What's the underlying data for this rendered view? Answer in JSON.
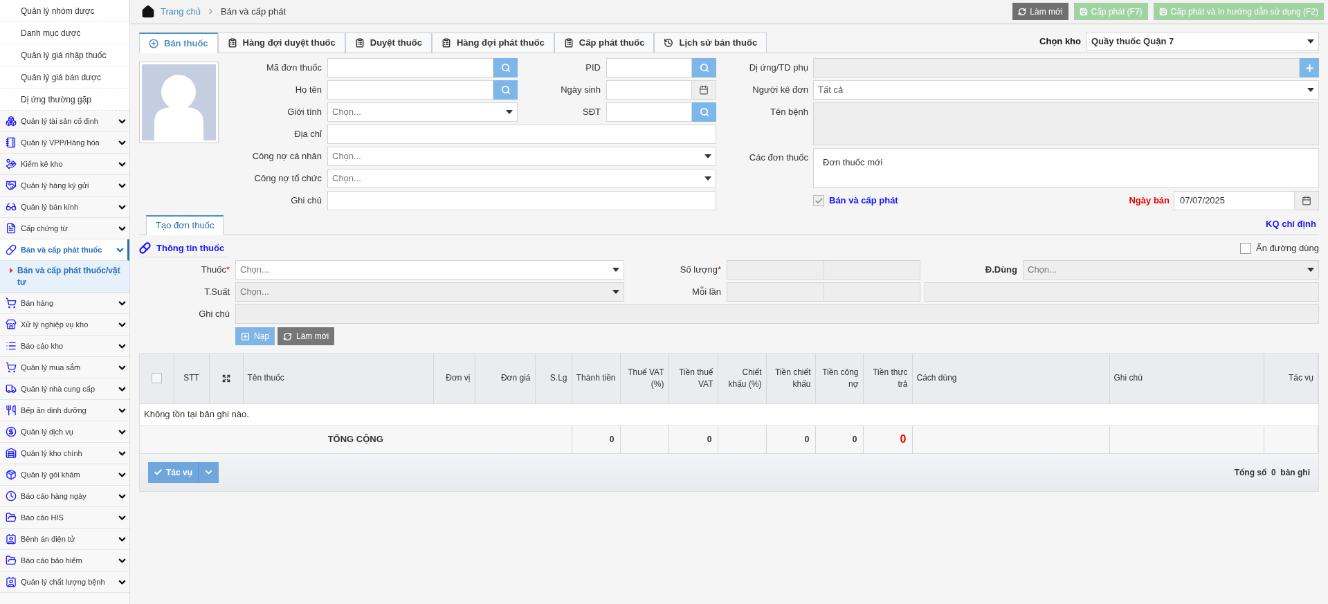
{
  "sidebar": {
    "submenu": [
      {
        "label": "Quản lý nhóm dược",
        "selected": false
      },
      {
        "label": "Danh mục dược",
        "selected": false
      },
      {
        "label": "Quản lý giá nhập thuốc",
        "selected": false
      },
      {
        "label": "Quản lý giá bán dược",
        "selected": false
      },
      {
        "label": "Dị ứng thường gặp",
        "selected": false
      }
    ],
    "items": [
      {
        "label": "Quản lý tài sản cố định",
        "selected": false
      },
      {
        "label": "Quản lý VPP/Hàng hóa",
        "selected": false
      },
      {
        "label": "Kiểm kê kho",
        "selected": false
      },
      {
        "label": "Quản lý hàng ký gửi",
        "selected": false
      },
      {
        "label": "Quản lý bán kính",
        "selected": false
      },
      {
        "label": "Cấp chứng từ",
        "selected": false
      },
      {
        "label": "Bán và cấp phát thuốc",
        "selected": true,
        "children": [
          {
            "label": "Bán và cấp phát thuốc/vật tư",
            "selected": true
          }
        ]
      },
      {
        "label": "Bán hàng",
        "selected": false
      },
      {
        "label": "Xử lý nghiệp vụ kho",
        "selected": false
      },
      {
        "label": "Báo cáo kho",
        "selected": false
      },
      {
        "label": "Quản lý mua sắm",
        "selected": false
      },
      {
        "label": "Quản lý nhà cung cấp",
        "selected": false
      },
      {
        "label": "Bếp ăn dinh dưỡng",
        "selected": false
      },
      {
        "label": "Quản lý dịch vụ",
        "selected": false
      },
      {
        "label": "Quản lý kho chính",
        "selected": false
      },
      {
        "label": "Quản lý gói khám",
        "selected": false
      },
      {
        "label": "Báo cáo hàng ngày",
        "selected": false
      },
      {
        "label": "Báo cáo HIS",
        "selected": false
      },
      {
        "label": "Bệnh án điện tử",
        "selected": false
      },
      {
        "label": "Báo cáo bảo hiểm",
        "selected": false
      },
      {
        "label": "Quản lý chất lượng bệnh",
        "selected": false
      }
    ]
  },
  "breadcrumb": [
    {
      "label": "Trang chủ",
      "kind": "link"
    },
    {
      "label": "Bán và cấp phát",
      "kind": "current"
    }
  ],
  "actions": [
    {
      "label": "Làm mới",
      "kind": "refresh",
      "disabled": false
    },
    {
      "label": "Cấp phát (F7)",
      "kind": "save",
      "disabled": true
    },
    {
      "label": "Cấp phát và In hướng dẫn sử dụng (F2)",
      "kind": "save",
      "disabled": true
    }
  ],
  "tabs": [
    {
      "label": "Bán thuốc",
      "selected": true
    },
    {
      "label": "Hàng đợi duyệt thuốc",
      "selected": false
    },
    {
      "label": "Duyệt thuốc",
      "selected": false
    },
    {
      "label": "Hàng đợi phát thuốc",
      "selected": false
    },
    {
      "label": "Cấp phát thuốc",
      "selected": false
    },
    {
      "label": "Lịch sử bán thuốc",
      "selected": false
    }
  ],
  "warehouse": {
    "label": "Chọn kho",
    "value": "Quầy thuốc Quận 7"
  },
  "patient": {
    "rows": [
      {
        "left": {
          "label": "Mã đơn thuốc",
          "kind": "search"
        },
        "middle": {
          "label": "PID",
          "kind": "search"
        }
      },
      {
        "left": {
          "label": "Họ tên",
          "kind": "search"
        },
        "middle": {
          "label": "Ngày sinh",
          "kind": "date"
        }
      },
      {
        "left": {
          "label": "Giới tính",
          "kind": "select",
          "placeholder": "Chọn..."
        },
        "middle": {
          "label": "SĐT",
          "kind": "search"
        }
      },
      {
        "left": {
          "label": "Địa chỉ",
          "kind": "text"
        }
      },
      {
        "left": {
          "label": "Công nợ cá nhân",
          "kind": "select",
          "placeholder": "Chọn..."
        }
      },
      {
        "left": {
          "label": "Công nợ tổ chức",
          "kind": "select",
          "placeholder": "Chọn..."
        }
      },
      {
        "left": {
          "label": "Ghi chú",
          "kind": "text"
        }
      }
    ]
  },
  "details": [
    {
      "label": "Dị ứng/TD phụ",
      "kind": "add",
      "disabled": true
    },
    {
      "label": "Người kê đơn",
      "kind": "select",
      "value": "Tất cả",
      "disabled": false
    },
    {
      "label": "Tên bệnh",
      "kind": "textarea",
      "disabled": true
    },
    {
      "label": "Các đơn thuốc",
      "kind": "list",
      "items": [
        "Đơn thuốc mới"
      ]
    }
  ],
  "sell_and_dispense": {
    "label": "Bán và cấp phát",
    "checked": true
  },
  "sale_date": {
    "label": "Ngày bán",
    "value": "07/07/2025"
  },
  "order_tabs": [
    {
      "label": "Tạo đơn thuốc",
      "selected": true
    }
  ],
  "result_link": "KQ chỉ định",
  "drug_info": {
    "title": "Thông tin thuốc",
    "hide_route": {
      "label": "Ẩn đường dùng",
      "checked": false
    },
    "drug": {
      "label": "Thuốc",
      "required_mark": "*",
      "placeholder": "Chọn...",
      "disabled": false
    },
    "quantity": {
      "label": "Số lượng",
      "required_mark": "*",
      "disabled": true
    },
    "route": {
      "label": "Đ.Dùng",
      "placeholder": "Chọn...",
      "disabled": true
    },
    "frequency": {
      "label": "T.Suất",
      "placeholder": "Chọn...",
      "disabled": true
    },
    "per_dose": {
      "label": "Mỗi lần",
      "disabled": true
    },
    "note": {
      "label": "Ghi chú",
      "disabled": true
    },
    "buttons": [
      {
        "label": "Nạp",
        "kind": "add",
        "disabled": true
      },
      {
        "label": "Làm mới",
        "kind": "refresh",
        "disabled": false
      }
    ]
  },
  "table": {
    "columns": [
      {
        "kind": "checkbox",
        "checked": false
      },
      {
        "kind": "text",
        "label": "STT"
      },
      {
        "kind": "expand"
      },
      {
        "kind": "text",
        "label": "Tên thuốc"
      },
      {
        "kind": "text",
        "label": "Đơn vị"
      },
      {
        "kind": "text",
        "label": "Đơn giá"
      },
      {
        "kind": "text",
        "label": "S.Lg"
      },
      {
        "kind": "text",
        "label": "Thành tiền"
      },
      {
        "kind": "text",
        "label": "Thuế VAT (%)"
      },
      {
        "kind": "text",
        "label": "Tiền thuế VAT"
      },
      {
        "kind": "text",
        "label": "Chiết khấu (%)"
      },
      {
        "kind": "text",
        "label": "Tiền chiết khấu"
      },
      {
        "kind": "text",
        "label": "Tiền công nợ"
      },
      {
        "kind": "text",
        "label": "Tiền thực trả"
      },
      {
        "kind": "text",
        "label": "Cách dùng"
      },
      {
        "kind": "text",
        "label": "Ghi chú"
      },
      {
        "kind": "text",
        "label": "Tác vụ"
      }
    ],
    "empty_message": "Không tồn tại bản ghi nào.",
    "totals": {
      "label": "TỔNG CỘNG",
      "cells": [
        {
          "value": "0",
          "emphasis": false
        },
        null,
        {
          "value": "0",
          "emphasis": false
        },
        null,
        {
          "value": "0",
          "emphasis": false
        },
        {
          "value": "0",
          "emphasis": false
        },
        {
          "value": "0",
          "emphasis": true
        },
        null,
        null,
        null
      ]
    }
  },
  "footer": {
    "action": "Tác vụ",
    "count": "Tổng số  0  bản ghi"
  }
}
